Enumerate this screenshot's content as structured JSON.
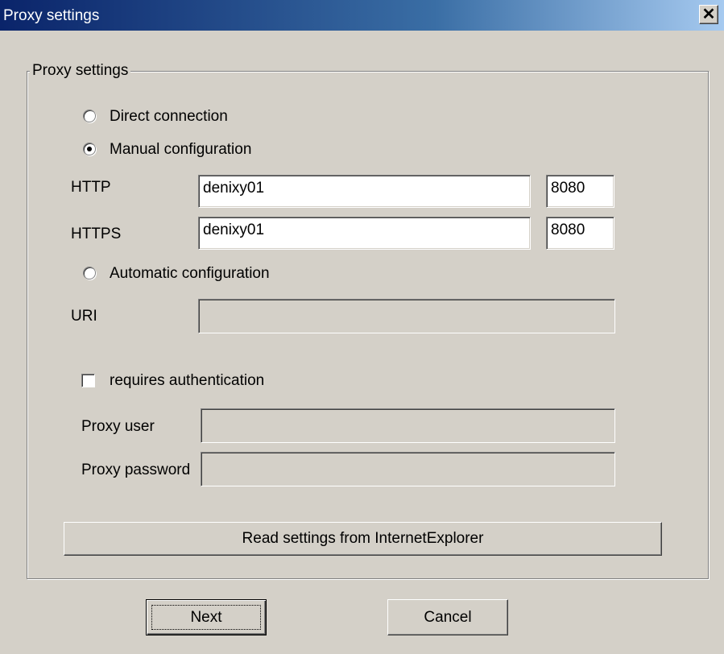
{
  "window": {
    "title": "Proxy settings"
  },
  "group": {
    "legend": "Proxy settings"
  },
  "options": {
    "direct_label": "Direct connection",
    "manual_label": "Manual configuration",
    "automatic_label": "Automatic configuration",
    "selected": "manual"
  },
  "http": {
    "label": "HTTP",
    "host": "denixy01",
    "port": "8080"
  },
  "https": {
    "label": "HTTPS",
    "host": "denixy01",
    "port": "8080"
  },
  "uri": {
    "label": "URI",
    "value": ""
  },
  "auth": {
    "checkbox_label": "requires authentication",
    "checked": false,
    "user_label": "Proxy user",
    "user_value": "",
    "password_label": "Proxy password",
    "password_value": ""
  },
  "buttons": {
    "read_ie": "Read settings from InternetExplorer",
    "next": "Next",
    "cancel": "Cancel"
  }
}
